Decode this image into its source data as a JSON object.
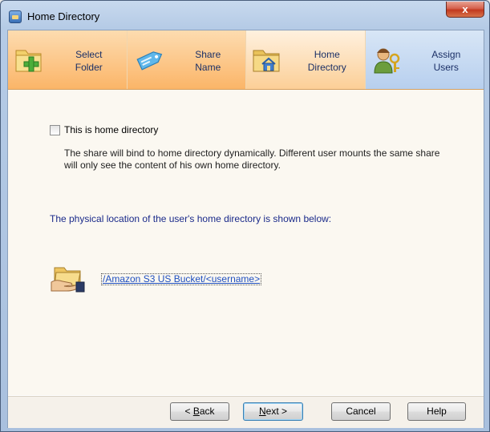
{
  "window": {
    "title": "Home Directory",
    "close_glyph": "x"
  },
  "steps": [
    {
      "label": "Select\nFolder",
      "icon": "folder-add-icon"
    },
    {
      "label": "Share\nName",
      "icon": "tag-icon"
    },
    {
      "label": "Home\nDirectory",
      "icon": "home-folder-icon"
    },
    {
      "label": "Assign\nUsers",
      "icon": "user-key-icon"
    }
  ],
  "active_step": "Home Directory",
  "checkbox": {
    "label": "This is home directory",
    "checked": false
  },
  "description": "The share will bind to home directory dynamically. Different user mounts the same share will only see the content of his own home directory.",
  "location_text": "The physical location of the user's home directory is shown below:",
  "path": {
    "icon": "folder-hand-icon",
    "link": "/Amazon S3 US Bucket/<username>"
  },
  "buttons": {
    "back_prefix": "< ",
    "back_mnemonic": "B",
    "back_rest": "ack",
    "next_mnemonic": "N",
    "next_rest": "ext >",
    "cancel": "Cancel",
    "help": "Help"
  },
  "colors": {
    "step_orange": "#fbb568",
    "step_blue": "#b7cfee",
    "link": "#1f4fbf",
    "location_text": "#1a2a8a"
  }
}
